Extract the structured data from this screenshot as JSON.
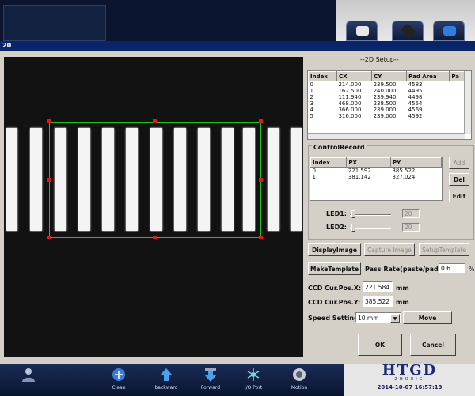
{
  "dialog": {
    "window_tag": "20"
  },
  "setup": {
    "title": "--2D Setup--",
    "pad_table": {
      "columns": [
        "Index",
        "CX",
        "CY",
        "Pad Area",
        "Pa"
      ],
      "rows": [
        [
          "0",
          "214.000",
          "239.500",
          "4583"
        ],
        [
          "1",
          "162.500",
          "240.000",
          "4495"
        ],
        [
          "2",
          "111.940",
          "239.940",
          "4498"
        ],
        [
          "3",
          "468.000",
          "238.500",
          "4554"
        ],
        [
          "4",
          "366.000",
          "239.000",
          "4569"
        ],
        [
          "5",
          "316.000",
          "239.000",
          "4592"
        ]
      ]
    },
    "control_record": {
      "title": "ControlRecord",
      "columns": [
        "Index",
        "PX",
        "PY"
      ],
      "rows": [
        [
          "0",
          "221.592",
          "385.522"
        ],
        [
          "1",
          "381.142",
          "327.024"
        ]
      ],
      "add_label": "Add",
      "del_label": "Del",
      "edit_label": "Edit"
    },
    "led1": {
      "label": "LED1:",
      "value": "20",
      "level": 0.05
    },
    "led2": {
      "label": "LED2:",
      "value": "20",
      "level": 0.05
    },
    "display_image_label": "DisplayImage",
    "capture_image_label": "Capture Image",
    "setup_template_label": "SetupTemplate",
    "make_template_label": "MakeTemplate",
    "pass_rate_label": "Pass Rate(paste/pad)",
    "pass_rate_value": "0.6",
    "pass_rate_unit": "%",
    "ccd_x_label": "CCD Cur.Pos.X:",
    "ccd_x_value": "221.584",
    "ccd_y_label": "CCD Cur.Pos.Y:",
    "ccd_y_value": "385.522",
    "unit_mm": "mm",
    "speed_label": "Speed Setting:",
    "speed_value": "10 mm",
    "move_label": "Move",
    "ok_label": "OK",
    "cancel_label": "Cancel"
  },
  "taskbar": {
    "items": [
      {
        "label": "",
        "icon": "user-icon"
      },
      {
        "label": "Clean",
        "icon": "clean-icon"
      },
      {
        "label": "backward",
        "icon": "up-arrow-icon"
      },
      {
        "label": "Forward",
        "icon": "down-arrow-icon"
      },
      {
        "label": "I/O Port",
        "icon": "io-port-icon"
      },
      {
        "label": "Motion",
        "icon": "motion-icon"
      }
    ]
  },
  "brand": {
    "logo": "HTGD",
    "sub": "ZHOUIG",
    "datetime": "2014-10-07  16:57:13"
  },
  "colors": {
    "roi": "#1ec21e",
    "handle": "#e01818",
    "title_bar": "#0a246a"
  }
}
